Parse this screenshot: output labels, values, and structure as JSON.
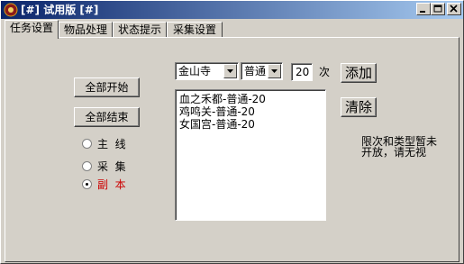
{
  "window": {
    "title": "[#] 试用版 [#]"
  },
  "title_buttons": {
    "minimize": "minimize",
    "maximize": "maximize",
    "close": "close"
  },
  "tabs": [
    {
      "label": "任务设置",
      "active": true
    },
    {
      "label": "物品处理",
      "active": false
    },
    {
      "label": "状态提示",
      "active": false
    },
    {
      "label": "采集设置",
      "active": false
    }
  ],
  "left_buttons": {
    "start_all": "全部开始",
    "end_all": "全部结束"
  },
  "radios": [
    {
      "label": "主  线",
      "selected": false,
      "color": "#000000"
    },
    {
      "label": "采  集",
      "selected": false,
      "color": "#000000"
    },
    {
      "label": "副  本",
      "selected": true,
      "color": "#cc0000"
    }
  ],
  "controls": {
    "location_select": "金山寺",
    "difficulty_select": "普通",
    "count_value": "20",
    "count_unit": "次",
    "add_button": "添加",
    "clear_button": "清除"
  },
  "task_list": [
    "血之禾都-普通-20",
    "鸡鸣关-普通-20",
    "女国宫-普通-20"
  ],
  "notice": [
    "限次和类型暂未",
    "开放，请无视"
  ]
}
